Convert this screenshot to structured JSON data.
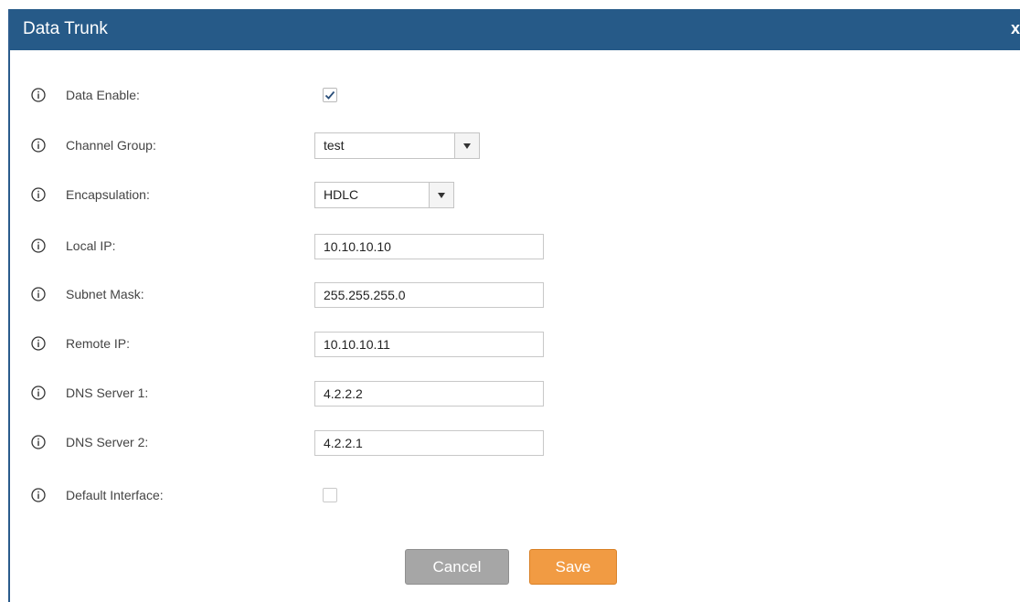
{
  "dialog": {
    "title": "Data Trunk",
    "close_label": "x"
  },
  "fields": {
    "data_enable": {
      "label": "Data Enable:",
      "checked": true
    },
    "channel_group": {
      "label": "Channel Group:",
      "value": "test"
    },
    "encapsulation": {
      "label": "Encapsulation:",
      "value": "HDLC"
    },
    "local_ip": {
      "label": "Local IP:",
      "value": "10.10.10.10"
    },
    "subnet_mask": {
      "label": "Subnet Mask:",
      "value": "255.255.255.0"
    },
    "remote_ip": {
      "label": "Remote IP:",
      "value": "10.10.10.11"
    },
    "dns_server_1": {
      "label": "DNS Server 1:",
      "value": "4.2.2.2"
    },
    "dns_server_2": {
      "label": "DNS Server 2:",
      "value": "4.2.2.1"
    },
    "default_interface": {
      "label": "Default Interface:",
      "checked": false
    }
  },
  "buttons": {
    "cancel": "Cancel",
    "save": "Save"
  },
  "icons": {
    "info": "info-circle-icon",
    "check": "checkmark-icon",
    "dropdown": "caret-down-icon"
  },
  "colors": {
    "titlebar": "#265a88",
    "save_button": "#f19b43",
    "cancel_button": "#a6a6a6"
  }
}
